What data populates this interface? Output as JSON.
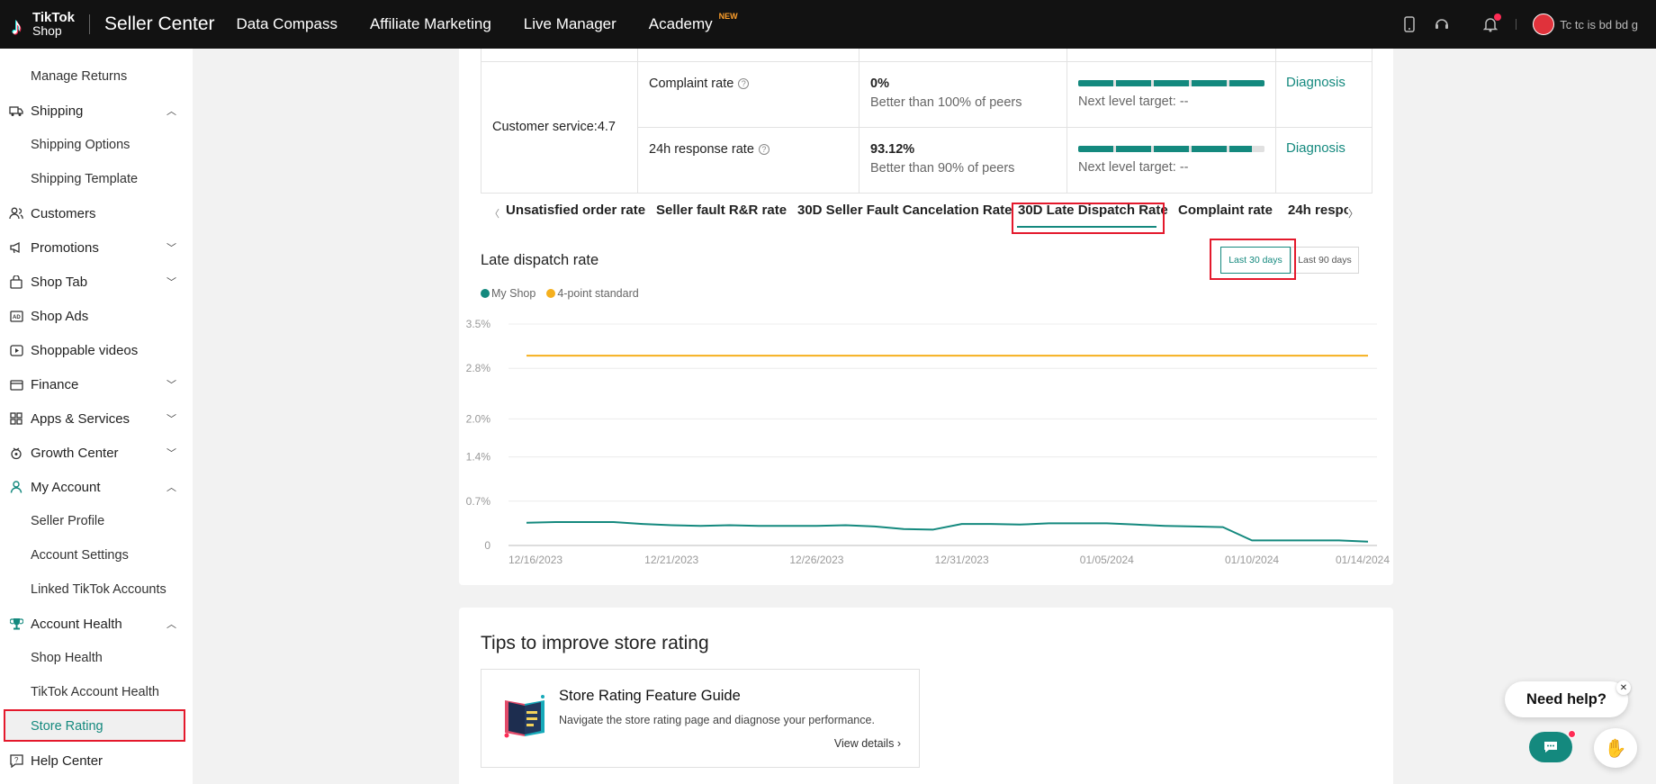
{
  "topbar": {
    "logo_line1": "TikTok",
    "logo_line2": "Shop",
    "app_title": "Seller Center",
    "nav": [
      "Data Compass",
      "Affiliate Marketing",
      "Live Manager",
      "Academy"
    ],
    "academy_badge": "NEW",
    "user_name": "Tc tc is bd bd g"
  },
  "sidebar": {
    "items": [
      {
        "label": "Manage Returns",
        "type": "sub"
      },
      {
        "label": "Shipping",
        "type": "section",
        "icon": "truck-icon",
        "expanded": true
      },
      {
        "label": "Shipping Options",
        "type": "sub"
      },
      {
        "label": "Shipping Template",
        "type": "sub"
      },
      {
        "label": "Customers",
        "type": "section",
        "icon": "users-icon"
      },
      {
        "label": "Promotions",
        "type": "section",
        "icon": "megaphone-icon",
        "expanded": false
      },
      {
        "label": "Shop Tab",
        "type": "section",
        "icon": "bag-icon",
        "expanded": false
      },
      {
        "label": "Shop Ads",
        "type": "section",
        "icon": "ads-icon"
      },
      {
        "label": "Shoppable videos",
        "type": "section",
        "icon": "video-icon"
      },
      {
        "label": "Finance",
        "type": "section",
        "icon": "wallet-icon",
        "expanded": false
      },
      {
        "label": "Apps & Services",
        "type": "section",
        "icon": "apps-icon",
        "expanded": false
      },
      {
        "label": "Growth Center",
        "type": "section",
        "icon": "growth-icon",
        "expanded": false
      },
      {
        "label": "My Account",
        "type": "section",
        "icon": "person-icon",
        "expanded": true
      },
      {
        "label": "Seller Profile",
        "type": "sub"
      },
      {
        "label": "Account Settings",
        "type": "sub"
      },
      {
        "label": "Linked TikTok Accounts",
        "type": "sub"
      },
      {
        "label": "Account Health",
        "type": "section",
        "icon": "trophy-icon",
        "expanded": true
      },
      {
        "label": "Shop Health",
        "type": "sub"
      },
      {
        "label": "TikTok Account Health",
        "type": "sub"
      },
      {
        "label": "Store Rating",
        "type": "sub",
        "selected": true
      },
      {
        "label": "Help Center",
        "type": "section",
        "icon": "help-icon"
      }
    ]
  },
  "metrics": {
    "group_label": "Customer service:4.7",
    "rows": [
      {
        "name": "Complaint rate",
        "value": "0%",
        "peer": "Better than 100% of peers",
        "progress": 1.0,
        "target": "Next level target: --",
        "action": "Diagnosis"
      },
      {
        "name": "24h response rate",
        "value": "93.12%",
        "peer": "Better than 90% of peers",
        "progress": 0.9312,
        "target": "Next level target: --",
        "action": "Diagnosis"
      }
    ]
  },
  "tabs": {
    "items": [
      "Unsatisfied order rate",
      "Seller fault R&R rate",
      "30D Seller Fault Cancelation Rate",
      "30D Late Dispatch Rate",
      "Complaint rate",
      "24h respo"
    ],
    "active_index": 3
  },
  "chart_section": {
    "title": "Late dispatch rate",
    "period_buttons": [
      "Last 30 days",
      "Last 90 days"
    ],
    "active_period": 0
  },
  "chart_data": {
    "type": "line",
    "title": "",
    "xlabel": "",
    "ylabel": "",
    "y_ticks": [
      "0",
      "0.7%",
      "1.4%",
      "2.0%",
      "2.8%",
      "3.5%"
    ],
    "y_tick_values": [
      0,
      0.7,
      1.4,
      2.0,
      2.8,
      3.5
    ],
    "ylim": [
      0,
      3.5
    ],
    "x_tick_labels": [
      "12/16/2023",
      "12/21/2023",
      "12/26/2023",
      "12/31/2023",
      "01/05/2024",
      "01/10/2024",
      "01/14/2024"
    ],
    "x": [
      "12/16/2023",
      "12/17/2023",
      "12/18/2023",
      "12/19/2023",
      "12/20/2023",
      "12/21/2023",
      "12/22/2023",
      "12/23/2023",
      "12/24/2023",
      "12/25/2023",
      "12/26/2023",
      "12/27/2023",
      "12/28/2023",
      "12/29/2023",
      "12/30/2023",
      "12/31/2023",
      "01/01/2024",
      "01/02/2024",
      "01/03/2024",
      "01/04/2024",
      "01/05/2024",
      "01/06/2024",
      "01/07/2024",
      "01/08/2024",
      "01/09/2024",
      "01/10/2024",
      "01/11/2024",
      "01/12/2024",
      "01/13/2024",
      "01/14/2024"
    ],
    "series": [
      {
        "name": "My Shop",
        "color": "#14897e",
        "values": [
          0.36,
          0.37,
          0.37,
          0.37,
          0.34,
          0.32,
          0.31,
          0.32,
          0.31,
          0.31,
          0.31,
          0.32,
          0.3,
          0.26,
          0.25,
          0.34,
          0.34,
          0.33,
          0.35,
          0.35,
          0.35,
          0.33,
          0.31,
          0.3,
          0.29,
          0.08,
          0.08,
          0.08,
          0.08,
          0.06
        ]
      },
      {
        "name": "4-point standard",
        "color": "#f5b01e",
        "values": [
          3.0,
          3.0,
          3.0,
          3.0,
          3.0,
          3.0,
          3.0,
          3.0,
          3.0,
          3.0,
          3.0,
          3.0,
          3.0,
          3.0,
          3.0,
          3.0,
          3.0,
          3.0,
          3.0,
          3.0,
          3.0,
          3.0,
          3.0,
          3.0,
          3.0,
          3.0,
          3.0,
          3.0,
          3.0,
          3.0
        ]
      }
    ],
    "legend": "top-left",
    "grid": true
  },
  "tips": {
    "title": "Tips to improve store rating",
    "card_title": "Store Rating Feature Guide",
    "card_desc": "Navigate the store rating page and diagnose your performance.",
    "card_link": "View details"
  },
  "help": {
    "label": "Need help?"
  },
  "colors": {
    "brand": "#14897e",
    "standard": "#f5b01e",
    "highlight": "#e4192c"
  }
}
